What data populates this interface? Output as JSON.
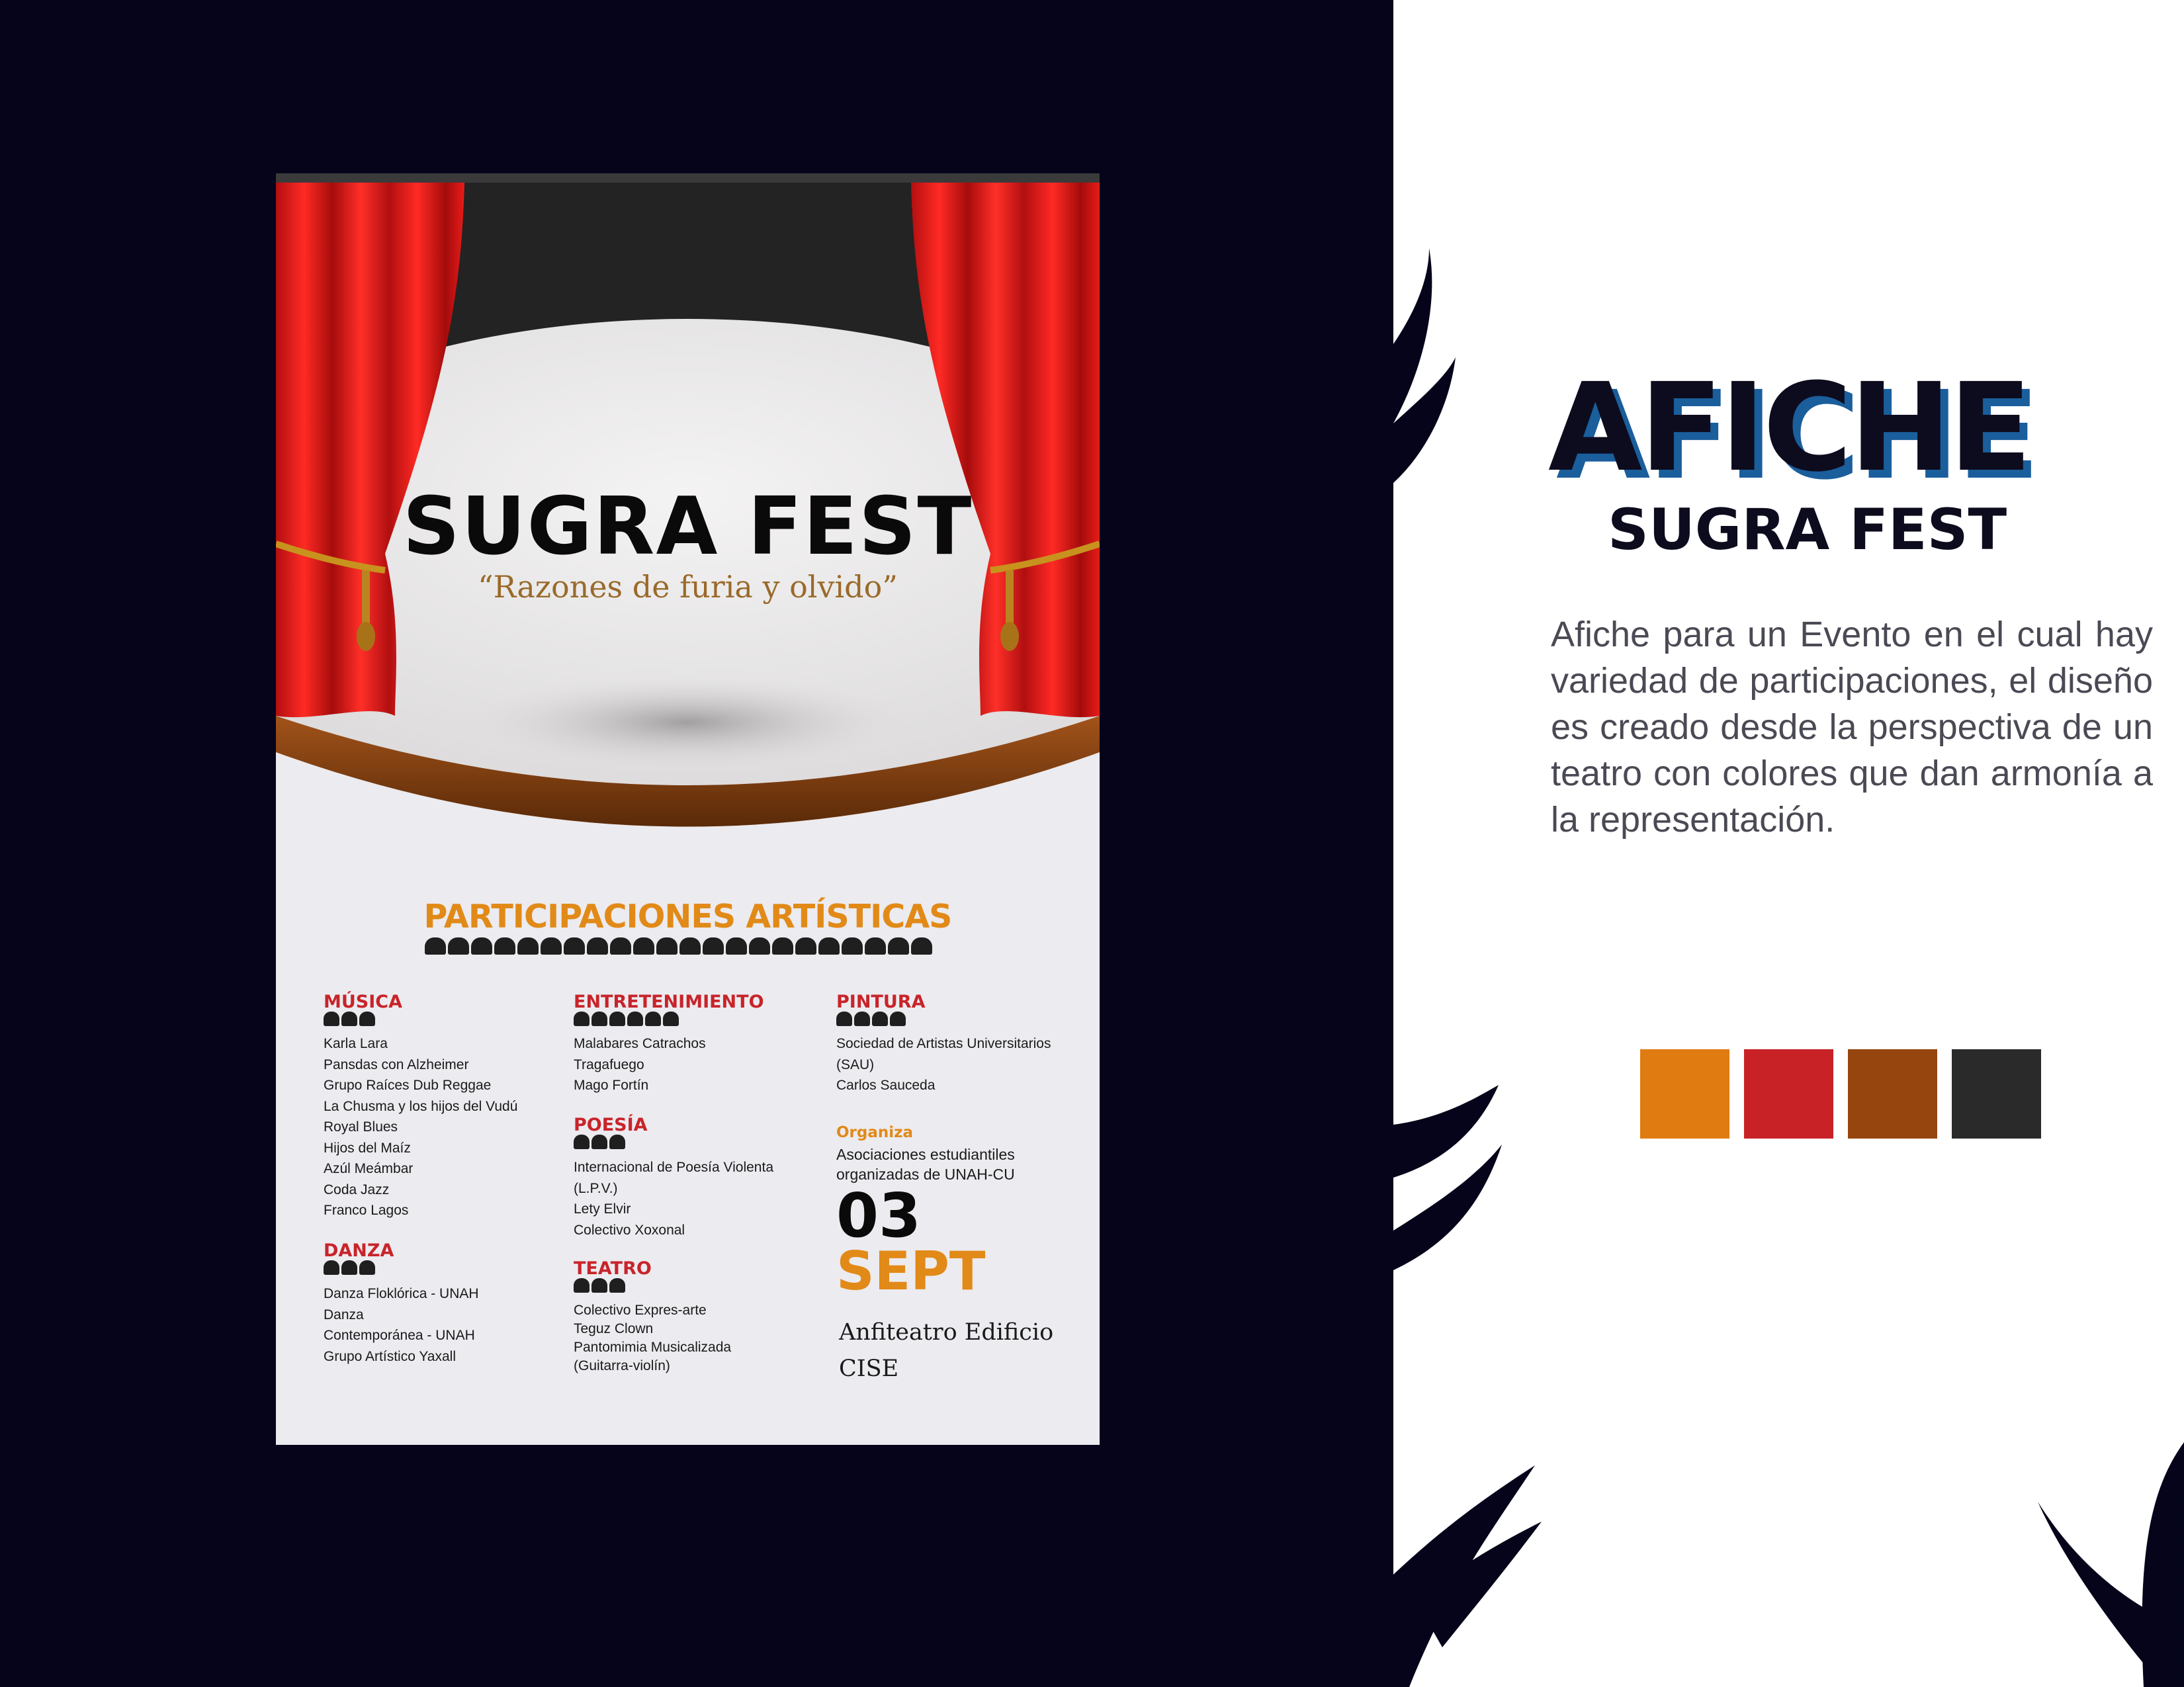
{
  "poster": {
    "title": "SUGRA FEST",
    "subtitle": "“Razones de furia y olvido”",
    "section_heading": "PARTICIPACIONES ARTÍSTICAS",
    "categories": {
      "musica": {
        "title": "MÚSICA",
        "items": [
          "Karla Lara",
          "Pansdas con Alzheimer",
          "Grupo Raíces Dub Reggae",
          "La Chusma y los hijos del Vudú",
          "Royal Blues",
          "Hijos del Maíz",
          "Azúl Meámbar",
          "Coda Jazz",
          "Franco Lagos"
        ]
      },
      "danza": {
        "title": "DANZA",
        "items": [
          "Danza Floklórica - UNAH",
          "Danza",
          "Contemporánea - UNAH",
          "Grupo Artístico Yaxall"
        ]
      },
      "entretenimiento": {
        "title": "ENTRETENIMIENTO",
        "items": [
          "Malabares Catrachos",
          "Tragafuego",
          "Mago Fortín"
        ]
      },
      "poesia": {
        "title": "POESÍA",
        "items": [
          "Internacional de Poesía Violenta",
          "(L.P.V.)",
          "Lety Elvir",
          "Colectivo Xoxonal"
        ]
      },
      "teatro": {
        "title": "TEATRO",
        "items": [
          "Colectivo Expres-arte",
          "Teguz Clown",
          "Pantomimia Musicalizada",
          "(Guitarra-violín)"
        ]
      },
      "pintura": {
        "title": "PINTURA",
        "items": [
          "Sociedad de Artistas Universitarios",
          "(SAU)",
          "Carlos Sauceda"
        ]
      }
    },
    "organiza": {
      "title": "Organiza",
      "text_line1": "Asociaciones estudiantiles",
      "text_line2": "organizadas de UNAH-CU"
    },
    "date": {
      "day": "03",
      "month": "SEPT"
    },
    "venue": {
      "line1": "Anfiteatro Edificio",
      "line2": "CISE"
    }
  },
  "info": {
    "title": "AFICHE",
    "subtitle": "SUGRA FEST",
    "description": "Afiche para un Evento en el cual hay variedad de participaciones, el diseño es creado desde la perspectiva de un teatro con colores que dan armonía a la representación."
  },
  "palette": [
    "#e07b12",
    "#c82227",
    "#96450f",
    "#2a2a2a"
  ],
  "colors": {
    "dark_background": "#05041a",
    "accent_orange": "#e18a18",
    "accent_red": "#c8242a",
    "title_shadow_blue": "#1a5e9c"
  }
}
